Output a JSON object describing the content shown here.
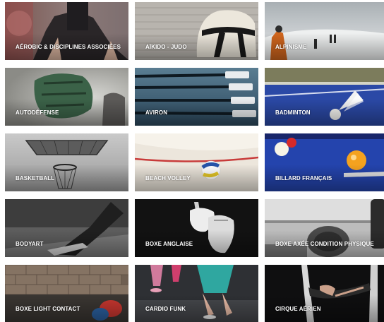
{
  "sports": [
    {
      "label": "AÉROBIC & DISCIPLINES ASSOCIÉES",
      "image": "aerobic-photo"
    },
    {
      "label": "AÏKIDO - JUDO",
      "image": "aikido-bag-photo"
    },
    {
      "label": "ALPINISME",
      "image": "alpinisme-photo"
    },
    {
      "label": "AUTODÉFENSE",
      "image": "autodefense-glove-photo"
    },
    {
      "label": "AVIRON",
      "image": "aviron-oars-photo"
    },
    {
      "label": "BADMINTON",
      "image": "badminton-shuttlecock-photo"
    },
    {
      "label": "BASKETBALL",
      "image": "basketball-hoop-photo"
    },
    {
      "label": "BEACH VOLLEY",
      "image": "beach-volley-ball-photo"
    },
    {
      "label": "BILLARD FRANÇAIS",
      "image": "billard-balls-photo"
    },
    {
      "label": "BODYART",
      "image": "bodyart-photo"
    },
    {
      "label": "BOXE ANGLAISE",
      "image": "boxe-gloves-photo"
    },
    {
      "label": "BOXE AXÉE CONDITION PHYSIQUE",
      "image": "boxe-condition-photo"
    },
    {
      "label": "BOXE LIGHT CONTACT",
      "image": "boxe-light-contact-photo"
    },
    {
      "label": "CARDIO FUNK",
      "image": "cardio-funk-photo"
    },
    {
      "label": "CIRQUE AÉRIEN",
      "image": "cirque-aerien-photo"
    }
  ]
}
